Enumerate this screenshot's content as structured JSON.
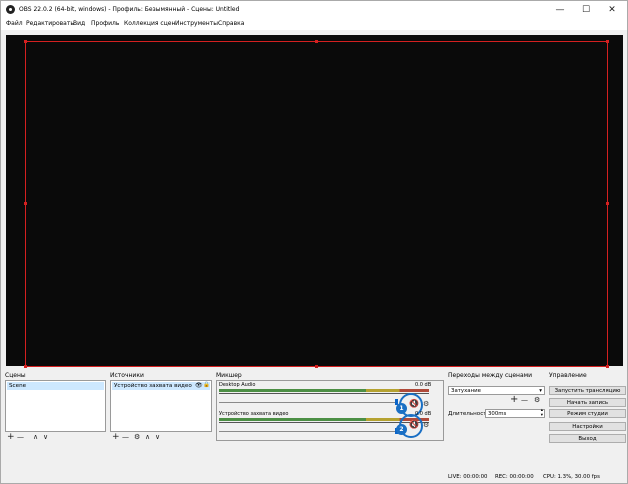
{
  "window": {
    "title": "OBS 22.0.2 (64-bit, windows) - Профиль: Безымянный - Сцены: Untitled",
    "minimize_glyph": "—",
    "maximize_glyph": "☐",
    "close_glyph": "✕"
  },
  "menu": [
    "Файл",
    "Редактировать",
    "Вид",
    "Профиль",
    "Коллекция сцен",
    "Инструменты",
    "Справка"
  ],
  "docks": {
    "scenes": {
      "title": "Сцены",
      "items": [
        "Scene"
      ]
    },
    "sources": {
      "title": "Источники",
      "items": [
        "Устройство захвата видео"
      ]
    },
    "mixer": {
      "title": "Микшер",
      "channels": [
        {
          "name": "Desktop Audio",
          "db": "0.0 dB",
          "badge": "1"
        },
        {
          "name": "Устройство захвата видео",
          "db": "0.0 dB",
          "badge": "2"
        }
      ]
    },
    "transitions": {
      "title": "Переходы между сценами",
      "selected": "Затухание",
      "duration_label": "Длительность",
      "duration_value": "300ms"
    },
    "controls": {
      "title": "Управление",
      "buttons": [
        "Запустить трансляцию",
        "Начать запись",
        "Режим студии",
        "Настройки",
        "Выход"
      ]
    }
  },
  "icons": {
    "add": "+",
    "remove": "—",
    "up": "∧",
    "down": "∨",
    "gear": "⚙",
    "eye": "👁",
    "lock": "🔒",
    "mute": "🔇",
    "dropdown": "▾",
    "spin_up": "▴",
    "spin_down": "▾"
  },
  "status": {
    "live": "LIVE: 00:00:00",
    "rec": "REC: 00:00:00",
    "cpu": "CPU: 1.3%, 30.00 fps"
  },
  "colors": {
    "accent": "#1a6fc4",
    "bounds": "#d42020",
    "mute": "#cc1d1d"
  }
}
